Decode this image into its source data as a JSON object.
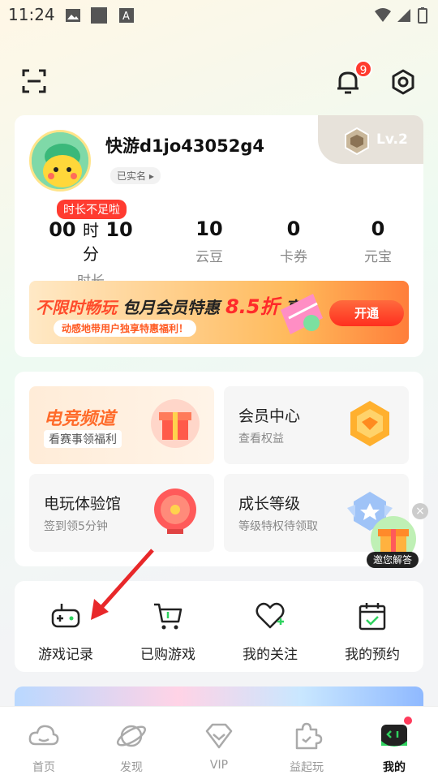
{
  "status_bar": {
    "time": "11:24"
  },
  "header": {
    "notification_count": "9"
  },
  "profile": {
    "username": "快游d1jo43052g4",
    "verified_label": "已实名 ▸",
    "level": "Lv.2",
    "time_warning": "时长不足啦",
    "stats": [
      {
        "value": "00",
        "unit1": "时",
        "value2": "10",
        "unit2": "分",
        "label": "时长"
      },
      {
        "value": "10",
        "label": "云豆"
      },
      {
        "value": "0",
        "label": "卡券"
      },
      {
        "value": "0",
        "label": "元宝"
      }
    ],
    "banner": {
      "title_part1": "不限时畅玩",
      "title_part2": "包月会员特惠",
      "discount": "8.5折",
      "title_part3": "享",
      "subtitle": "动感地带用户独享特惠福利！",
      "button": "开通"
    }
  },
  "features": [
    {
      "title": "电竞频道",
      "subtitle": "看赛事领福利"
    },
    {
      "title": "会员中心",
      "subtitle": "查看权益"
    },
    {
      "title": "电玩体验馆",
      "subtitle": "签到领5分钟"
    },
    {
      "title": "成长等级",
      "subtitle": "等级特权待领取"
    }
  ],
  "help": {
    "label": "邀您解答",
    "close": "×"
  },
  "quick_actions": [
    {
      "label": "游戏记录",
      "icon": "gamepad-icon"
    },
    {
      "label": "已购游戏",
      "icon": "cart-icon"
    },
    {
      "label": "我的关注",
      "icon": "heart-plus-icon"
    },
    {
      "label": "我的预约",
      "icon": "calendar-check-icon"
    }
  ],
  "bottom_nav": [
    {
      "label": "首页",
      "icon": "cloud-icon"
    },
    {
      "label": "发现",
      "icon": "planet-icon"
    },
    {
      "label": "VIP",
      "icon": "diamond-icon"
    },
    {
      "label": "益起玩",
      "icon": "puzzle-icon"
    },
    {
      "label": "我的",
      "icon": "profile-face-icon",
      "active": true
    }
  ],
  "colors": {
    "accent": "#ff3b30",
    "brand_green": "#2fd35f",
    "banner_orange": "#ff7e3a"
  }
}
